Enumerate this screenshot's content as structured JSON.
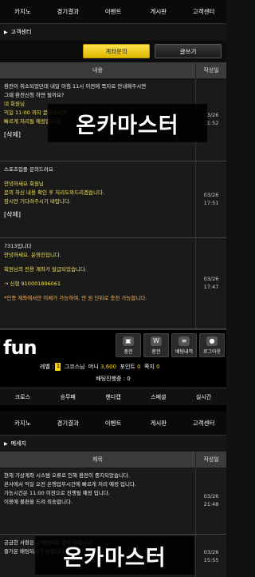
{
  "top_nav": [
    "카지노",
    "경기결과",
    "이벤트",
    "게시판",
    "고객센터"
  ],
  "breadcrumb1": "고객센터",
  "buttons": {
    "account_inquiry": "계좌문의",
    "write": "글쓰기"
  },
  "table1": {
    "col_content": "내용",
    "col_date": "작성일",
    "rows": [
      {
        "lines": [
          {
            "text": "환전이 취소되었던데 내일 아침 11시 이전에 쪽지로 안내해주시면",
            "c": "w"
          },
          {
            "text": "그때 환전신청 하면 될까요?",
            "c": "w"
          },
          {
            "text": "네 회원님",
            "c": "y"
          },
          {
            "text": "익일 11:00 까지 문의하시면",
            "c": "y"
          },
          {
            "text": "빠르게 처리될 예정입니다.",
            "c": "y"
          }
        ],
        "delete": "[삭제]",
        "date": "03/26 21:52"
      },
      {
        "lines": [
          {
            "text": "스포츠입플 문의드려요",
            "c": "w"
          },
          {
            "text": "",
            "c": "w"
          },
          {
            "text": "안녕하세요 회원님",
            "c": "y"
          },
          {
            "text": "문의 하신 내용 확인 후 처리도와드리겠습니다.",
            "c": "y"
          },
          {
            "text": "잠시만 기다려주시기 바랍니다.",
            "c": "y"
          }
        ],
        "delete": "[삭제]",
        "date": "03/26 17:51"
      },
      {
        "lines": [
          {
            "text": "7313입니다",
            "c": "w"
          },
          {
            "text": "안녕하세요. 운영진입니다.",
            "c": "y"
          },
          {
            "text": "",
            "c": "w"
          },
          {
            "text": "회원님의 전용 계좌가 발급되었습니다.",
            "c": "y"
          },
          {
            "text": "",
            "c": "w"
          },
          {
            "text": "→ 신협 910001896061",
            "c": "y"
          },
          {
            "text": "",
            "c": "w"
          },
          {
            "text": "*인증 계좌에서만 이체가 가능하며, 만 원 단위로 충전 가능합니다.",
            "c": "o"
          }
        ],
        "delete": "",
        "date": "03/26 17:47"
      }
    ]
  },
  "watermark": "온카마스터",
  "app": {
    "logo": "fun",
    "icons": [
      {
        "name": "deposit-icon",
        "label": "충전",
        "glyph": "▣"
      },
      {
        "name": "withdraw-icon",
        "label": "환전",
        "glyph": "W"
      },
      {
        "name": "bet-history-icon",
        "label": "배팅내역",
        "glyph": "≡"
      },
      {
        "name": "logout-icon",
        "label": "로그아웃",
        "glyph": "●"
      }
    ],
    "level_label": "레벨 :",
    "level_value": "1",
    "user": "그코스님",
    "money_label": "머니",
    "money_value": "3,600",
    "point_label": "포인트",
    "point_value": "0",
    "note_label": "쪽지",
    "note_value": "0",
    "bet_pending": "배팅진행중 : 0",
    "tabs": [
      "크로스",
      "승무패",
      "핸디캡",
      "스페셜",
      "실시간"
    ]
  },
  "breadcrumb2": "메세지",
  "table2": {
    "col_title": "제목",
    "col_date": "작성일",
    "rows": [
      {
        "lines": [
          {
            "text": "현재 가상계좌 시스템 오류로 인해 환전이 중지되었습니다.",
            "c": "g"
          },
          {
            "text": "본사에서 익일 오전 은행업무시간에 빠르게 처리 예정 입니다.",
            "c": "g"
          },
          {
            "text": "가능시간은 11:00 이전으로 진행될 예정 입니다.",
            "c": "g"
          },
          {
            "text": "이용에 불편을 드려 죄송합니다.",
            "c": "g"
          }
        ],
        "date": "03/26 21:48"
      },
      {
        "lines": [
          {
            "text": "궁금한 사항은 고객센터로 문의 바랍니다.",
            "c": "g"
          },
          {
            "text": "즐거운 배팅되시기 바랍니다.",
            "c": "g"
          }
        ],
        "date": "03/26 15:55"
      }
    ]
  }
}
